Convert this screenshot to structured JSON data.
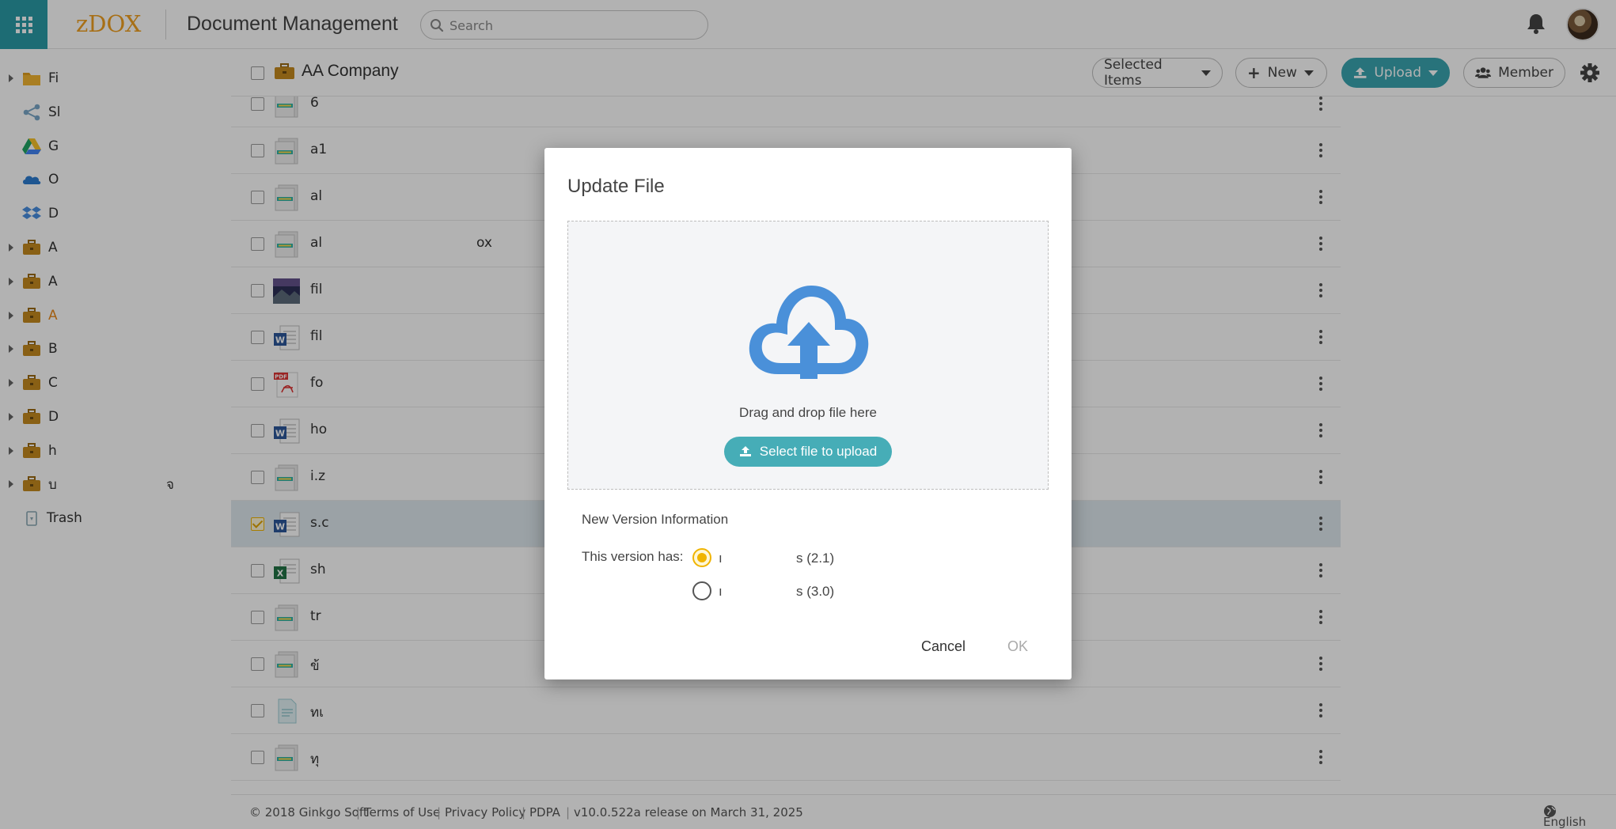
{
  "header": {
    "logo_text": "zDOX",
    "app_title": "Document Management",
    "search_placeholder": "Search"
  },
  "sidebar": {
    "items": [
      {
        "label": "Fi",
        "icon": "folder-icon",
        "has_caret": true
      },
      {
        "label": "Sl",
        "icon": "share-icon",
        "has_caret": false
      },
      {
        "label": "G",
        "icon": "google-drive-icon",
        "has_caret": false
      },
      {
        "label": "O",
        "icon": "onedrive-icon",
        "has_caret": false
      },
      {
        "label": "D",
        "icon": "dropbox-icon",
        "has_caret": false
      },
      {
        "label": "A",
        "icon": "briefcase-icon",
        "has_caret": true
      },
      {
        "label": "A",
        "icon": "briefcase-icon",
        "has_caret": true
      },
      {
        "label": "A",
        "icon": "briefcase-icon",
        "has_caret": true,
        "active": true
      },
      {
        "label": "B",
        "icon": "briefcase-icon",
        "has_caret": true
      },
      {
        "label": "C",
        "icon": "briefcase-icon",
        "has_caret": true
      },
      {
        "label": "D",
        "icon": "briefcase-icon",
        "has_caret": true
      },
      {
        "label": "h",
        "icon": "briefcase-icon",
        "has_caret": true
      },
      {
        "label": "บ",
        "extra": "จ",
        "icon": "briefcase-icon",
        "has_caret": true
      }
    ],
    "trash_label": "Trash"
  },
  "main": {
    "breadcrumb": "AA Company",
    "buttons": {
      "selected_items": "Selected Items",
      "new": "New",
      "upload": "Upload",
      "member": "Member"
    },
    "files": [
      {
        "name": "6",
        "icon": "zip-icon",
        "extra": ""
      },
      {
        "name": "a1",
        "icon": "zip-icon",
        "extra": ""
      },
      {
        "name": "al",
        "icon": "zip-icon",
        "extra": ""
      },
      {
        "name": "al",
        "icon": "zip-icon",
        "extra": "ox"
      },
      {
        "name": "fil",
        "icon": "image-icon",
        "extra": ""
      },
      {
        "name": "fil",
        "icon": "word-icon",
        "extra": ""
      },
      {
        "name": "fo",
        "icon": "pdf-icon",
        "extra": ""
      },
      {
        "name": "ho",
        "icon": "word-icon",
        "extra": ""
      },
      {
        "name": "i.z",
        "icon": "zip-icon",
        "extra": ""
      },
      {
        "name": "s.c",
        "icon": "word-icon",
        "extra": "",
        "selected": true
      },
      {
        "name": "sh",
        "icon": "excel-icon",
        "extra": ""
      },
      {
        "name": "tr",
        "icon": "zip-icon",
        "extra": ""
      },
      {
        "name": "ข้",
        "icon": "zip-icon",
        "extra": ""
      },
      {
        "name": "ทเ",
        "icon": "text-doc-icon",
        "extra": ""
      },
      {
        "name": "ทุ",
        "icon": "zip-icon",
        "extra": ""
      }
    ]
  },
  "footer": {
    "copyright": "© 2018 Ginkgo Soft",
    "terms": "Terms of Use",
    "privacy": "Privacy Policy",
    "pdpa": "PDPA",
    "version": "v10.0.522a release on March 31, 2025",
    "language": "English"
  },
  "modal": {
    "title": "Update File",
    "drop_text": "Drag and drop file here",
    "select_button": "Select file to upload",
    "section_title": "New Version Information",
    "version_label": "This version has:",
    "options": [
      {
        "label_start": "ı",
        "label_end": "s (2.1)",
        "selected": true
      },
      {
        "label_start": "ı",
        "label_end": "s (3.0)",
        "selected": false
      }
    ],
    "cancel": "Cancel",
    "ok": "OK"
  },
  "colors": {
    "brand_teal": "#2a9ba7",
    "logo_orange": "#f0a020",
    "upload_blue": "#4a90d9",
    "radio_selected": "#f0b400"
  }
}
